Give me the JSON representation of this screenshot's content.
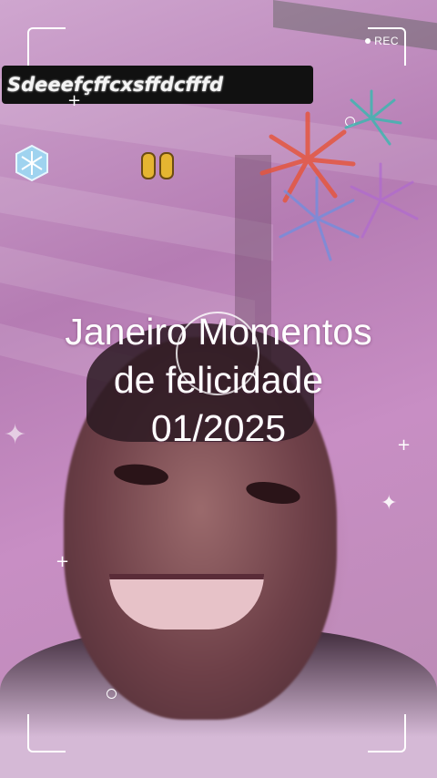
{
  "overlay": {
    "username": "Sdeeefçffcxsffdcfffd",
    "recording_label": "REC"
  },
  "caption": {
    "line1": "Janeiro Momentos",
    "line2": "de felicidade",
    "line3": "01/2025"
  },
  "icons": {
    "record_dot": "record-dot-icon",
    "snowflake": "snowflake-icon",
    "sticker": "hands-sticker-icon",
    "fireworks": "fireworks-icon",
    "focus": "focus-ring-icon"
  },
  "colors": {
    "overlay_text": "#ffffff",
    "username_bg": "#111111",
    "tint": "#c88ec4"
  }
}
